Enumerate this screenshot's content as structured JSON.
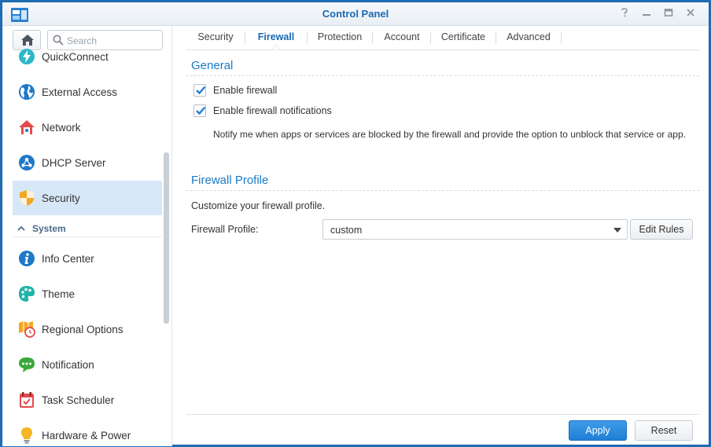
{
  "window": {
    "title": "Control Panel",
    "controls": {
      "help": "?",
      "minimize": "—",
      "maximize": "□",
      "close": "✕"
    }
  },
  "sidebar": {
    "search_placeholder": "Search",
    "items": [
      {
        "label": "QuickConnect",
        "icon": "quickconnect-icon"
      },
      {
        "label": "External Access",
        "icon": "globe-icon"
      },
      {
        "label": "Network",
        "icon": "house-network-icon"
      },
      {
        "label": "DHCP Server",
        "icon": "dhcp-icon"
      },
      {
        "label": "Security",
        "icon": "shield-icon",
        "active": true
      }
    ],
    "section": {
      "label": "System"
    },
    "system_items": [
      {
        "label": "Info Center",
        "icon": "info-icon"
      },
      {
        "label": "Theme",
        "icon": "palette-icon"
      },
      {
        "label": "Regional Options",
        "icon": "regional-clock-icon"
      },
      {
        "label": "Notification",
        "icon": "chat-bubble-icon"
      },
      {
        "label": "Task Scheduler",
        "icon": "calendar-check-icon"
      },
      {
        "label": "Hardware & Power",
        "icon": "lightbulb-icon"
      }
    ]
  },
  "tabs": [
    {
      "label": "Security"
    },
    {
      "label": "Firewall",
      "active": true
    },
    {
      "label": "Protection"
    },
    {
      "label": "Account"
    },
    {
      "label": "Certificate"
    },
    {
      "label": "Advanced"
    }
  ],
  "general": {
    "title": "General",
    "enable_firewall": {
      "label": "Enable firewall",
      "checked": true
    },
    "enable_notifications": {
      "label": "Enable firewall notifications",
      "checked": true
    },
    "notify_description": "Notify me when apps or services are blocked by the firewall and provide the option to unblock that service or app."
  },
  "profile": {
    "title": "Firewall Profile",
    "description": "Customize your firewall profile.",
    "field_label": "Firewall Profile:",
    "selected": "custom",
    "edit_rules_label": "Edit Rules"
  },
  "footer": {
    "apply_label": "Apply",
    "reset_label": "Reset"
  },
  "colors": {
    "accent": "#1b68b3",
    "section_title": "#1b7bc6",
    "active_item_bg": "#d6e8f8",
    "primary_button": "#2a8ae0"
  }
}
